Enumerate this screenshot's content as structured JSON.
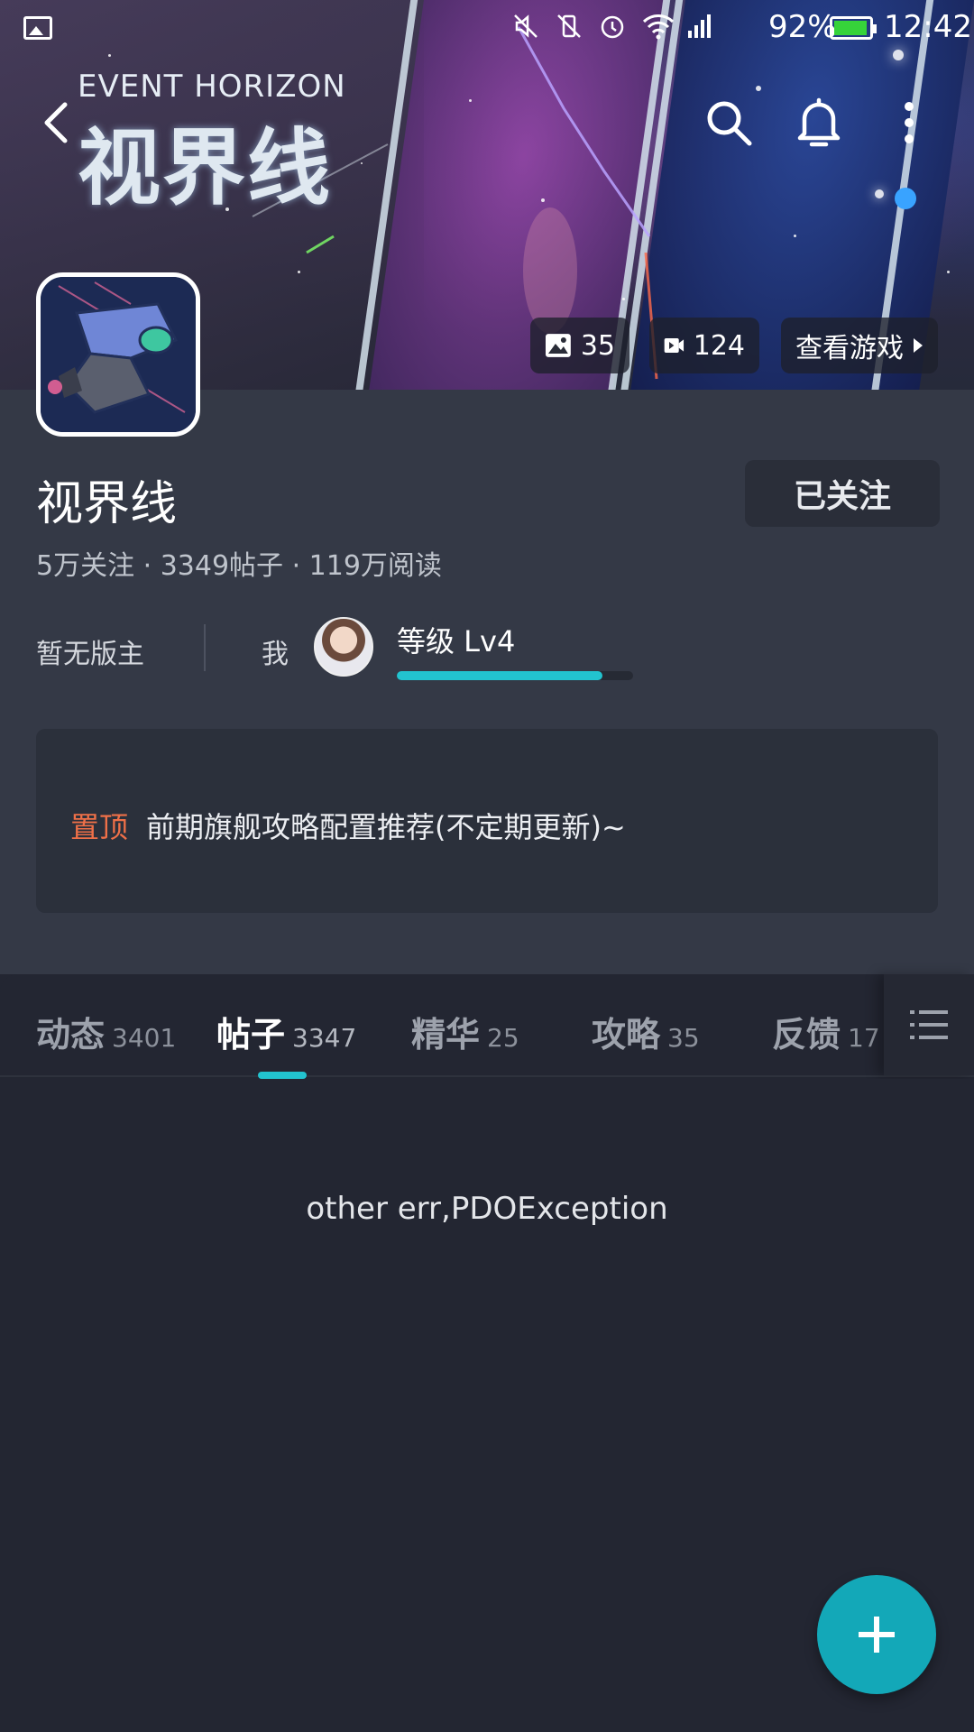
{
  "status_bar": {
    "battery_percent": "92%",
    "time": "12:42",
    "icons": [
      "gallery-icon",
      "mute-icon",
      "vibrate-off-icon",
      "alarm-icon",
      "wifi-icon",
      "signal-icon",
      "battery-icon"
    ]
  },
  "banner": {
    "title_en": "EVENT HORIZON",
    "title_cn": "视界线",
    "photos_count": "35",
    "videos_count": "124",
    "view_game_label": "查看游戏"
  },
  "forum": {
    "name": "视界线",
    "follow_label": "已关注",
    "stats": "5万关注 · 3349帖子 · 119万阅读",
    "moderator_text": "暂无版主",
    "me_label": "我",
    "level_label": "等级 Lv4",
    "level_progress": 0.87
  },
  "pinned": {
    "tag": "置顶",
    "title": "前期旗舰攻略配置推荐(不定期更新)~"
  },
  "tabs": [
    {
      "label": "动态",
      "count": "3401",
      "active": false
    },
    {
      "label": "帖子",
      "count": "3347",
      "active": true
    },
    {
      "label": "精华",
      "count": "25",
      "active": false
    },
    {
      "label": "攻略",
      "count": "35",
      "active": false
    },
    {
      "label": "反馈",
      "count": "17",
      "active": false
    }
  ],
  "content": {
    "error_message": "other err,PDOException"
  },
  "colors": {
    "accent": "#22c3cf",
    "fab": "#13a8b8",
    "pinned_tag": "#ef7048",
    "background": "#232632",
    "info_background": "#343946"
  }
}
